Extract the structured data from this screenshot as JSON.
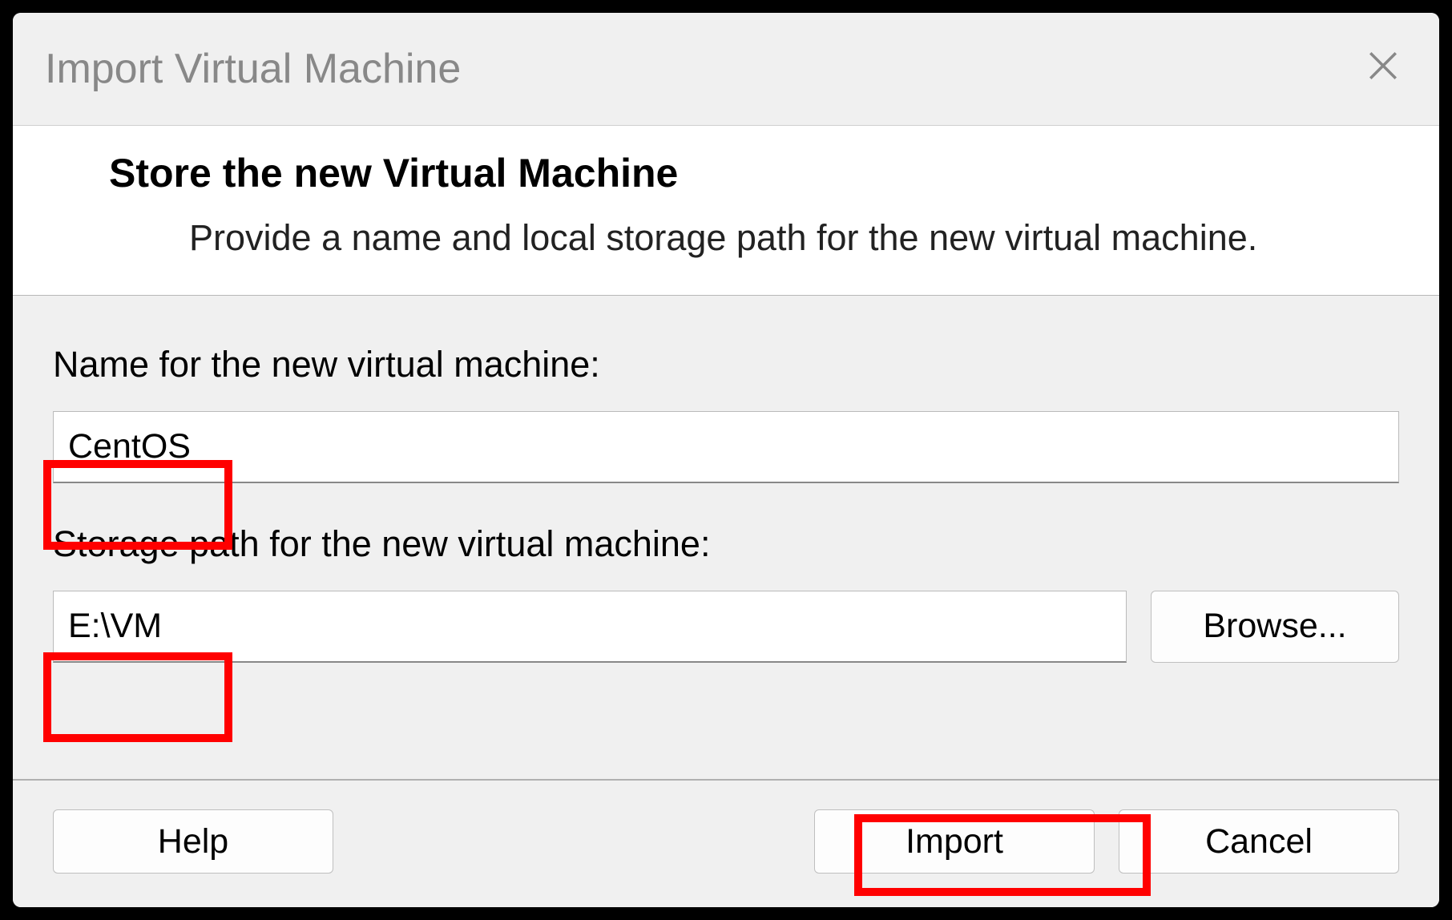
{
  "dialog": {
    "title": "Import Virtual Machine"
  },
  "header": {
    "title": "Store the new Virtual Machine",
    "description": "Provide a name and local storage path for the new virtual machine."
  },
  "fields": {
    "name_label": "Name for the new virtual machine:",
    "name_value": "CentOS",
    "path_label": "Storage path for the new virtual machine:",
    "path_value": "E:\\VM",
    "browse_label": "Browse..."
  },
  "footer": {
    "help_label": "Help",
    "import_label": "Import",
    "cancel_label": "Cancel"
  },
  "highlights": {
    "color": "#ff0000"
  }
}
